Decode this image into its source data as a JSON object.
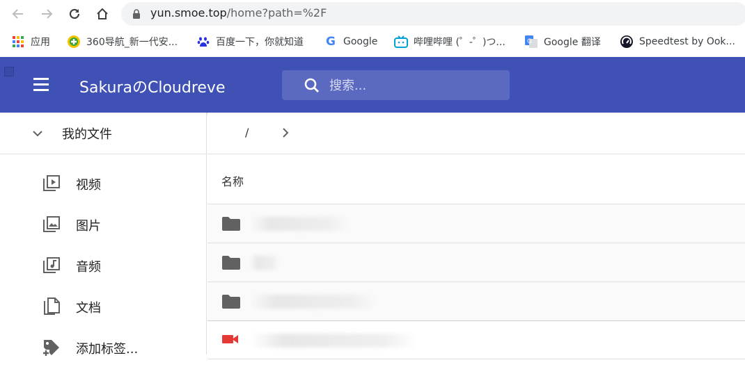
{
  "browser": {
    "url_host": "yun.smoe.top",
    "url_path": "/home?path=%2F",
    "bookmarks": [
      {
        "label": "应用",
        "icon": "apps-grid-icon"
      },
      {
        "label": "360导航_新一代安...",
        "icon": "360-icon"
      },
      {
        "label": "百度一下，你就知道",
        "icon": "baidu-paw-icon"
      },
      {
        "label": "Google",
        "icon": "google-g-icon"
      },
      {
        "label": "哔哩哔哩 (゜-゜)つ...",
        "icon": "bilibili-tv-icon"
      },
      {
        "label": "Google 翻译",
        "icon": "google-translate-icon"
      },
      {
        "label": "Speedtest by Ook...",
        "icon": "speedtest-gauge-icon"
      }
    ]
  },
  "app": {
    "brand": "SakuraのCloudreve",
    "search_placeholder": "搜索...",
    "accent": "#3f51b5"
  },
  "sidebar": {
    "header": "我的文件",
    "items": [
      {
        "label": "视频",
        "icon": "video-library-icon"
      },
      {
        "label": "图片",
        "icon": "photo-library-icon"
      },
      {
        "label": "音频",
        "icon": "music-library-icon"
      },
      {
        "label": "文档",
        "icon": "documents-icon"
      },
      {
        "label": "添加标签...",
        "icon": "add-tag-icon"
      }
    ]
  },
  "main": {
    "breadcrumb_root": "/",
    "column_name": "名称",
    "rows": [
      {
        "type": "folder",
        "name": ""
      },
      {
        "type": "folder",
        "name": ""
      },
      {
        "type": "folder",
        "name": ""
      },
      {
        "type": "video",
        "name": ""
      }
    ]
  }
}
